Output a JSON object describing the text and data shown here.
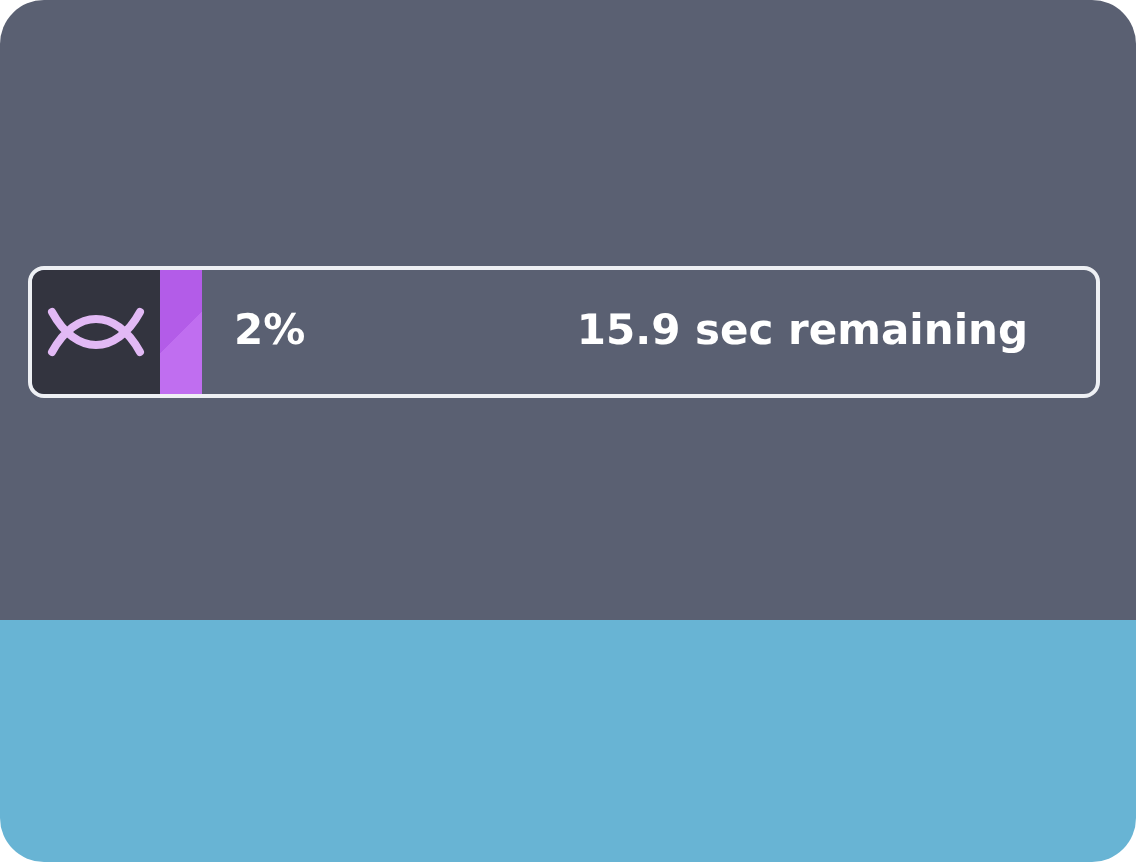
{
  "progress": {
    "percent": "2%",
    "remaining": "15.9 sec remaining"
  }
}
